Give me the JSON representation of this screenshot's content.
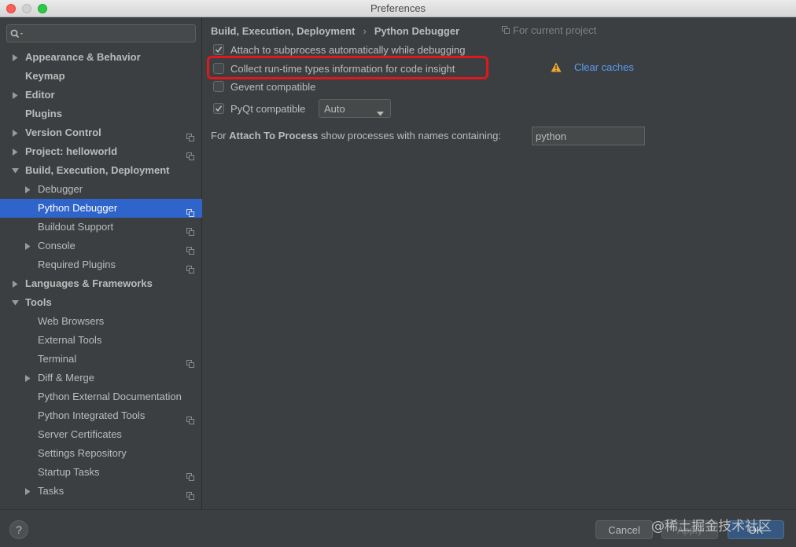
{
  "window": {
    "title": "Preferences"
  },
  "search": {
    "placeholder": ""
  },
  "sidebar": {
    "items": [
      {
        "label": "Appearance & Behavior",
        "level": 0,
        "arrow": "right",
        "bold": true,
        "project": false,
        "selected": false
      },
      {
        "label": "Keymap",
        "level": 0,
        "arrow": "",
        "bold": true,
        "project": false,
        "selected": false
      },
      {
        "label": "Editor",
        "level": 0,
        "arrow": "right",
        "bold": true,
        "project": false,
        "selected": false
      },
      {
        "label": "Plugins",
        "level": 0,
        "arrow": "",
        "bold": true,
        "project": false,
        "selected": false
      },
      {
        "label": "Version Control",
        "level": 0,
        "arrow": "right",
        "bold": true,
        "project": true,
        "selected": false
      },
      {
        "label": "Project: helloworld",
        "level": 0,
        "arrow": "right",
        "bold": true,
        "project": true,
        "selected": false
      },
      {
        "label": "Build, Execution, Deployment",
        "level": 0,
        "arrow": "down",
        "bold": true,
        "project": false,
        "selected": false
      },
      {
        "label": "Debugger",
        "level": 1,
        "arrow": "right",
        "bold": false,
        "project": false,
        "selected": false
      },
      {
        "label": "Python Debugger",
        "level": 1,
        "arrow": "",
        "bold": false,
        "project": true,
        "selected": true
      },
      {
        "label": "Buildout Support",
        "level": 1,
        "arrow": "",
        "bold": false,
        "project": true,
        "selected": false
      },
      {
        "label": "Console",
        "level": 1,
        "arrow": "right",
        "bold": false,
        "project": true,
        "selected": false
      },
      {
        "label": "Required Plugins",
        "level": 1,
        "arrow": "",
        "bold": false,
        "project": true,
        "selected": false
      },
      {
        "label": "Languages & Frameworks",
        "level": 0,
        "arrow": "right",
        "bold": true,
        "project": false,
        "selected": false
      },
      {
        "label": "Tools",
        "level": 0,
        "arrow": "down",
        "bold": true,
        "project": false,
        "selected": false
      },
      {
        "label": "Web Browsers",
        "level": 1,
        "arrow": "",
        "bold": false,
        "project": false,
        "selected": false
      },
      {
        "label": "External Tools",
        "level": 1,
        "arrow": "",
        "bold": false,
        "project": false,
        "selected": false
      },
      {
        "label": "Terminal",
        "level": 1,
        "arrow": "",
        "bold": false,
        "project": true,
        "selected": false
      },
      {
        "label": "Diff & Merge",
        "level": 1,
        "arrow": "right",
        "bold": false,
        "project": false,
        "selected": false
      },
      {
        "label": "Python External Documentation",
        "level": 1,
        "arrow": "",
        "bold": false,
        "project": false,
        "selected": false
      },
      {
        "label": "Python Integrated Tools",
        "level": 1,
        "arrow": "",
        "bold": false,
        "project": true,
        "selected": false
      },
      {
        "label": "Server Certificates",
        "level": 1,
        "arrow": "",
        "bold": false,
        "project": false,
        "selected": false
      },
      {
        "label": "Settings Repository",
        "level": 1,
        "arrow": "",
        "bold": false,
        "project": false,
        "selected": false
      },
      {
        "label": "Startup Tasks",
        "level": 1,
        "arrow": "",
        "bold": false,
        "project": true,
        "selected": false
      },
      {
        "label": "Tasks",
        "level": 1,
        "arrow": "right",
        "bold": false,
        "project": true,
        "selected": false
      }
    ]
  },
  "breadcrumb": {
    "parent": "Build, Execution, Deployment",
    "separator": "›",
    "current": "Python Debugger",
    "scope": "For current project"
  },
  "options": {
    "attach_subprocess": {
      "label": "Attach to subprocess automatically while debugging",
      "checked": true
    },
    "collect_types": {
      "label": "Collect run-time types information for code insight",
      "checked": false
    },
    "gevent": {
      "label": "Gevent compatible",
      "checked": false
    },
    "pyqt": {
      "label": "PyQt compatible",
      "checked": true,
      "selected_value": "Auto"
    }
  },
  "clear_caches": "Clear caches",
  "attach_to_process": {
    "prefix": "For ",
    "bold": "Attach To Process",
    "suffix": " show processes with names containing:",
    "value": "python"
  },
  "buttons": {
    "help": "?",
    "cancel": "Cancel",
    "apply": "Apply",
    "ok": "OK"
  },
  "watermark": "@稀土掘金技术社区",
  "colors": {
    "selection": "#2f65ca",
    "highlight_box": "#e0171b",
    "link": "#589df6",
    "warning": "#f0a732"
  }
}
